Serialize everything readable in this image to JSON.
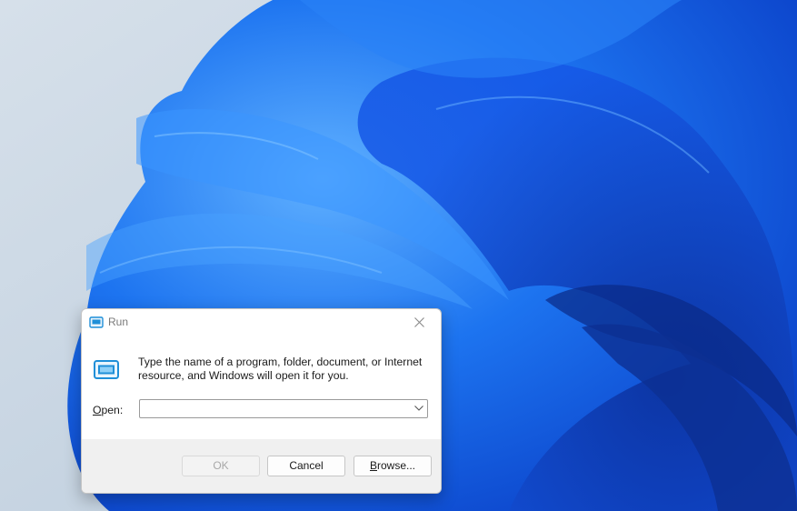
{
  "dialog": {
    "title": "Run",
    "description": "Type the name of a program, folder, document, or Internet resource, and Windows will open it for you.",
    "open_label_mnemonic": "O",
    "open_label_rest": "pen:",
    "open_value": "",
    "ok_label": "OK",
    "cancel_label": "Cancel",
    "browse_label_mnemonic": "B",
    "browse_label_rest": "rowse..."
  },
  "icons": {
    "title": "run-icon",
    "body": "run-icon",
    "close": "close-icon",
    "dropdown": "chevron-down-icon"
  },
  "colors": {
    "accent": "#1f8fd8",
    "wallpaper_blue": "#1559e8"
  }
}
